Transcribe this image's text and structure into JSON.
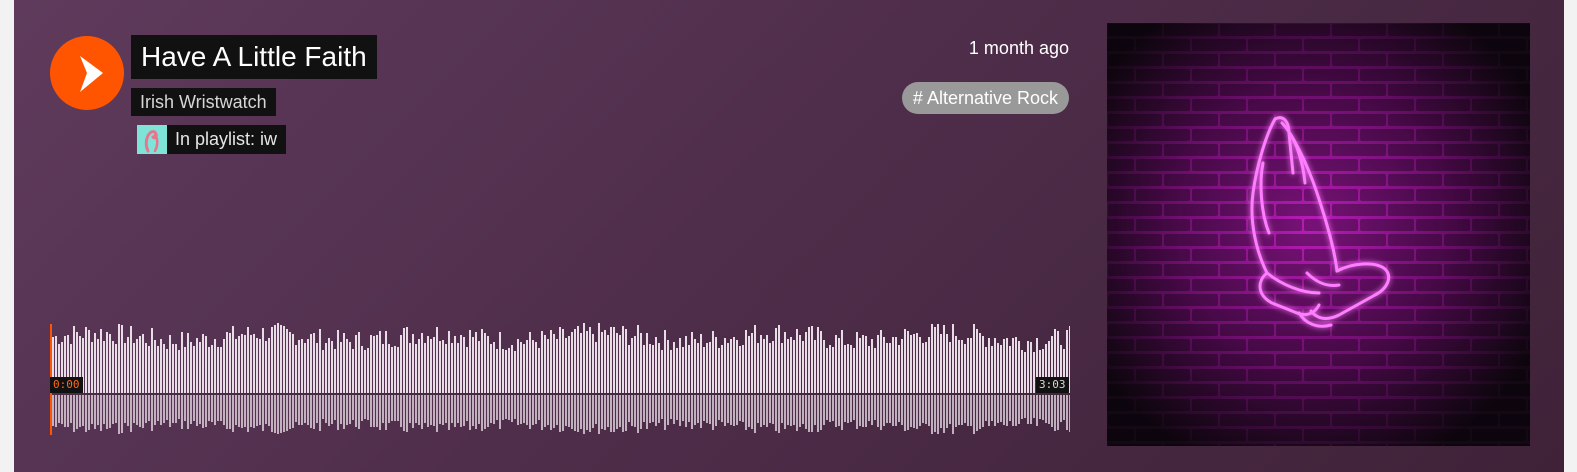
{
  "track": {
    "title": "Have A Little Faith",
    "artist": "Irish Wristwatch",
    "playlist_label": "In playlist: iw",
    "posted": "1 month ago",
    "tag": "# Alternative Rock",
    "time_current": "0:00",
    "time_total": "3:03",
    "progress_fraction": 0
  },
  "colors": {
    "accent": "#ff5500",
    "waveform_bar": "#e8dce6",
    "waveform_played": "#ff5500",
    "artwork_neon": "#ff3cff",
    "artwork_brick": "#c21fc2"
  },
  "icons": {
    "play": "play-icon",
    "playlist_thumb": "flamingo-icon",
    "artwork": "praying-hands-neon"
  }
}
